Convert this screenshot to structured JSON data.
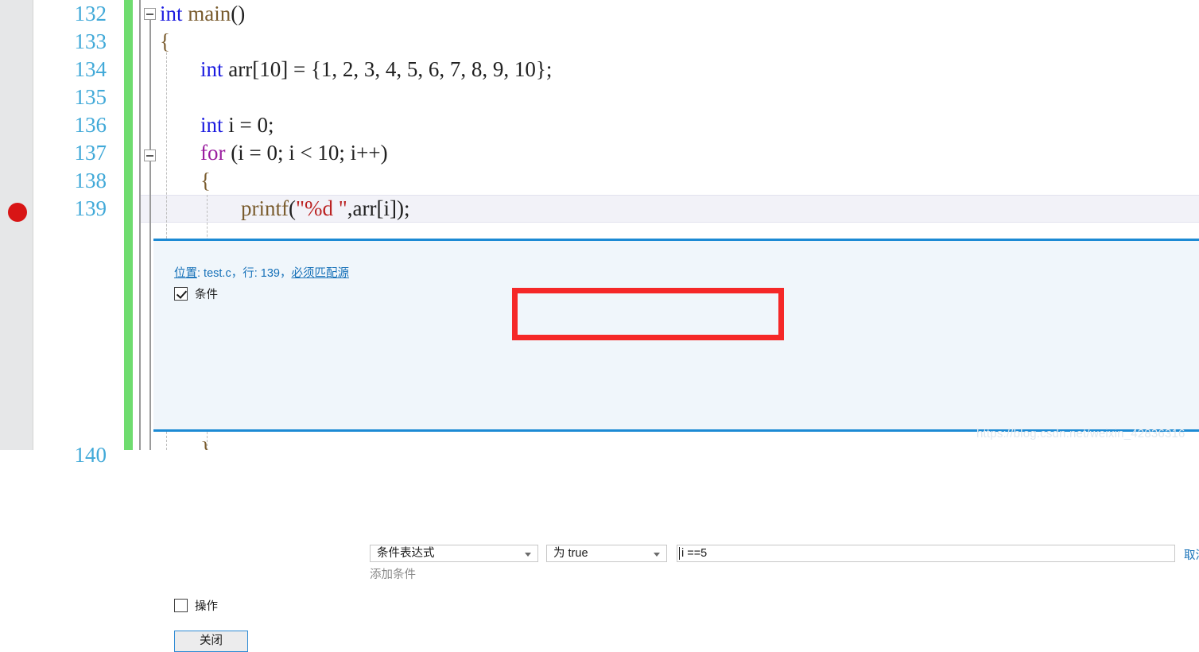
{
  "editor": {
    "line_numbers": [
      "132",
      "133",
      "134",
      "135",
      "136",
      "137",
      "138",
      "139",
      "140"
    ],
    "current_line": "139",
    "breakpoint_line": "139",
    "lines": [
      {
        "number": "132",
        "text": "int main()"
      },
      {
        "number": "133",
        "text": "{"
      },
      {
        "number": "134",
        "text": "int arr[10] = {1, 2, 3, 4, 5, 6, 7, 8, 9, 10};"
      },
      {
        "number": "135",
        "text": ""
      },
      {
        "number": "136",
        "text": "int i = 0;"
      },
      {
        "number": "137",
        "text": "for (i = 0; i < 10; i++)"
      },
      {
        "number": "138",
        "text": "{"
      },
      {
        "number": "139",
        "text": "printf(\"%d \",arr[i]);"
      },
      {
        "number": "140",
        "text": "}"
      }
    ],
    "tokens": {
      "l132_kw": "int",
      "l132_fn": "main",
      "l132_paren": "()",
      "l133_brace": "{",
      "l134_kw": "int",
      "l134_name": "arr",
      "l134_rest": "[10] = {1, 2, 3, 4, 5, 6, 7, 8, 9, 10};",
      "l136_kw": "int",
      "l136_rest": "i = 0;",
      "l137_kw": "for",
      "l137_rest": "(i = 0; i < 10; i++)",
      "l138_brace": "{",
      "l139_fn": "printf",
      "l139_open": "(",
      "l139_str": "\"%d \"",
      "l139_comma": ",",
      "l139_arr": "arr",
      "l139_idx": "[i]);",
      "l140_brace": "}"
    },
    "colors": {
      "keyword": "#1a1ae0",
      "control_keyword": "#9b1fa0",
      "function": "#7a5c2e",
      "string": "#bb2222",
      "line_number": "#41a9d8",
      "change_bar": "#6fdc6f",
      "breakpoint": "#d81515",
      "current_line_bg": "#f2f2f8"
    }
  },
  "peek": {
    "location_prefix": "位置",
    "location_text": ": test.c，行: 139，",
    "location_suffix": "必须匹配源",
    "condition": {
      "checkbox_label": "条件",
      "checked": true,
      "type_value": "条件表达式",
      "comparison_value": "为 true",
      "expression_value": "i ==5",
      "cancel_label": "取消",
      "add_condition_label": "添加条件"
    },
    "action": {
      "checkbox_label": "操作",
      "checked": false
    },
    "close_button_label": "关闭",
    "accent_color": "#1c8ad4",
    "highlight_color": "#f52828"
  },
  "watermark": {
    "text": "https://blog.csdn.net/weixin_42836316"
  }
}
